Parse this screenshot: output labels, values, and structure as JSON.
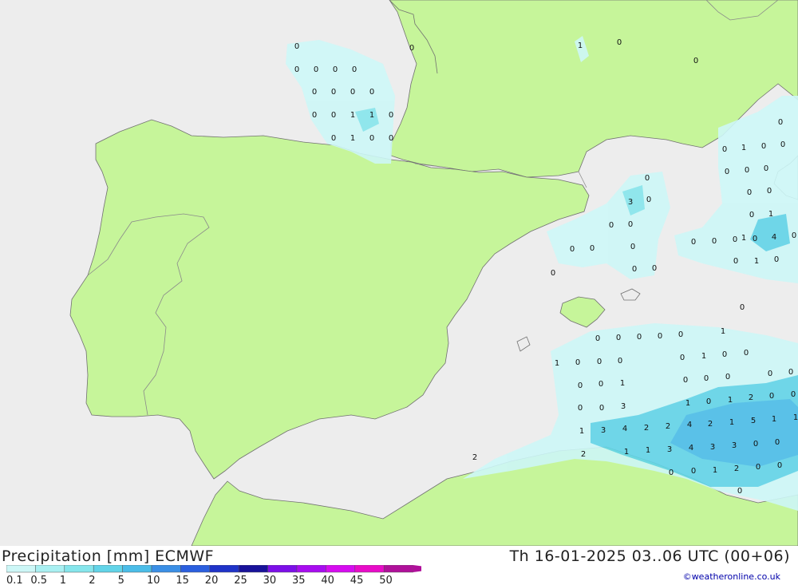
{
  "title": "Precipitation [mm]  ECMWF",
  "datetime": "Th 16-01-2025 03..06 UTC (00+06)",
  "credit": "©weatheronline.co.uk",
  "colors": {
    "sea": "#ededed",
    "land": "#c6f59a",
    "border": "#8a8a8a",
    "coast": "#707070"
  },
  "legend": {
    "labels": [
      "0.1",
      "0.5",
      "1",
      "2",
      "5",
      "10",
      "15",
      "20",
      "25",
      "30",
      "35",
      "40",
      "45",
      "50"
    ],
    "colors": [
      "#cdf7f7",
      "#a9f0f2",
      "#86e6ec",
      "#62d4e8",
      "#4bbde8",
      "#3b8fe6",
      "#2b5fdf",
      "#1f33c8",
      "#18129a",
      "#7c0fe8",
      "#a80cf0",
      "#d60cf0",
      "#e80cc8",
      "#b0109a"
    ]
  },
  "values": [
    "0",
    "0",
    "0",
    "0",
    "0",
    "0",
    "0",
    "0",
    "0",
    "0",
    "0",
    "0",
    "1",
    "1",
    "0",
    "0",
    "1",
    "0",
    "0",
    "0",
    "1",
    "0",
    "0",
    "0",
    "1",
    "0",
    "0",
    "0",
    "0",
    "0",
    "0",
    "0",
    "0",
    "0",
    "1",
    "0",
    "0",
    "0",
    "1",
    "4",
    "0",
    "0",
    "1",
    "0",
    "3",
    "0",
    "0",
    "0",
    "0",
    "0",
    "0",
    "0",
    "0",
    "0",
    "0",
    "0",
    "0",
    "0",
    "0",
    "0",
    "0",
    "1",
    "1",
    "0",
    "0",
    "0",
    "0",
    "1",
    "0",
    "0",
    "0",
    "0",
    "1",
    "0",
    "0",
    "0",
    "0",
    "0",
    "0",
    "0",
    "3",
    "1",
    "0",
    "1",
    "2",
    "0",
    "0",
    "1",
    "3",
    "4",
    "2",
    "2",
    "4",
    "2",
    "1",
    "5",
    "1",
    "1",
    "1",
    "1",
    "3",
    "4",
    "3",
    "3",
    "0",
    "0",
    "2",
    "2",
    "1",
    "2",
    "0",
    "0",
    "0",
    "0",
    "0"
  ]
}
